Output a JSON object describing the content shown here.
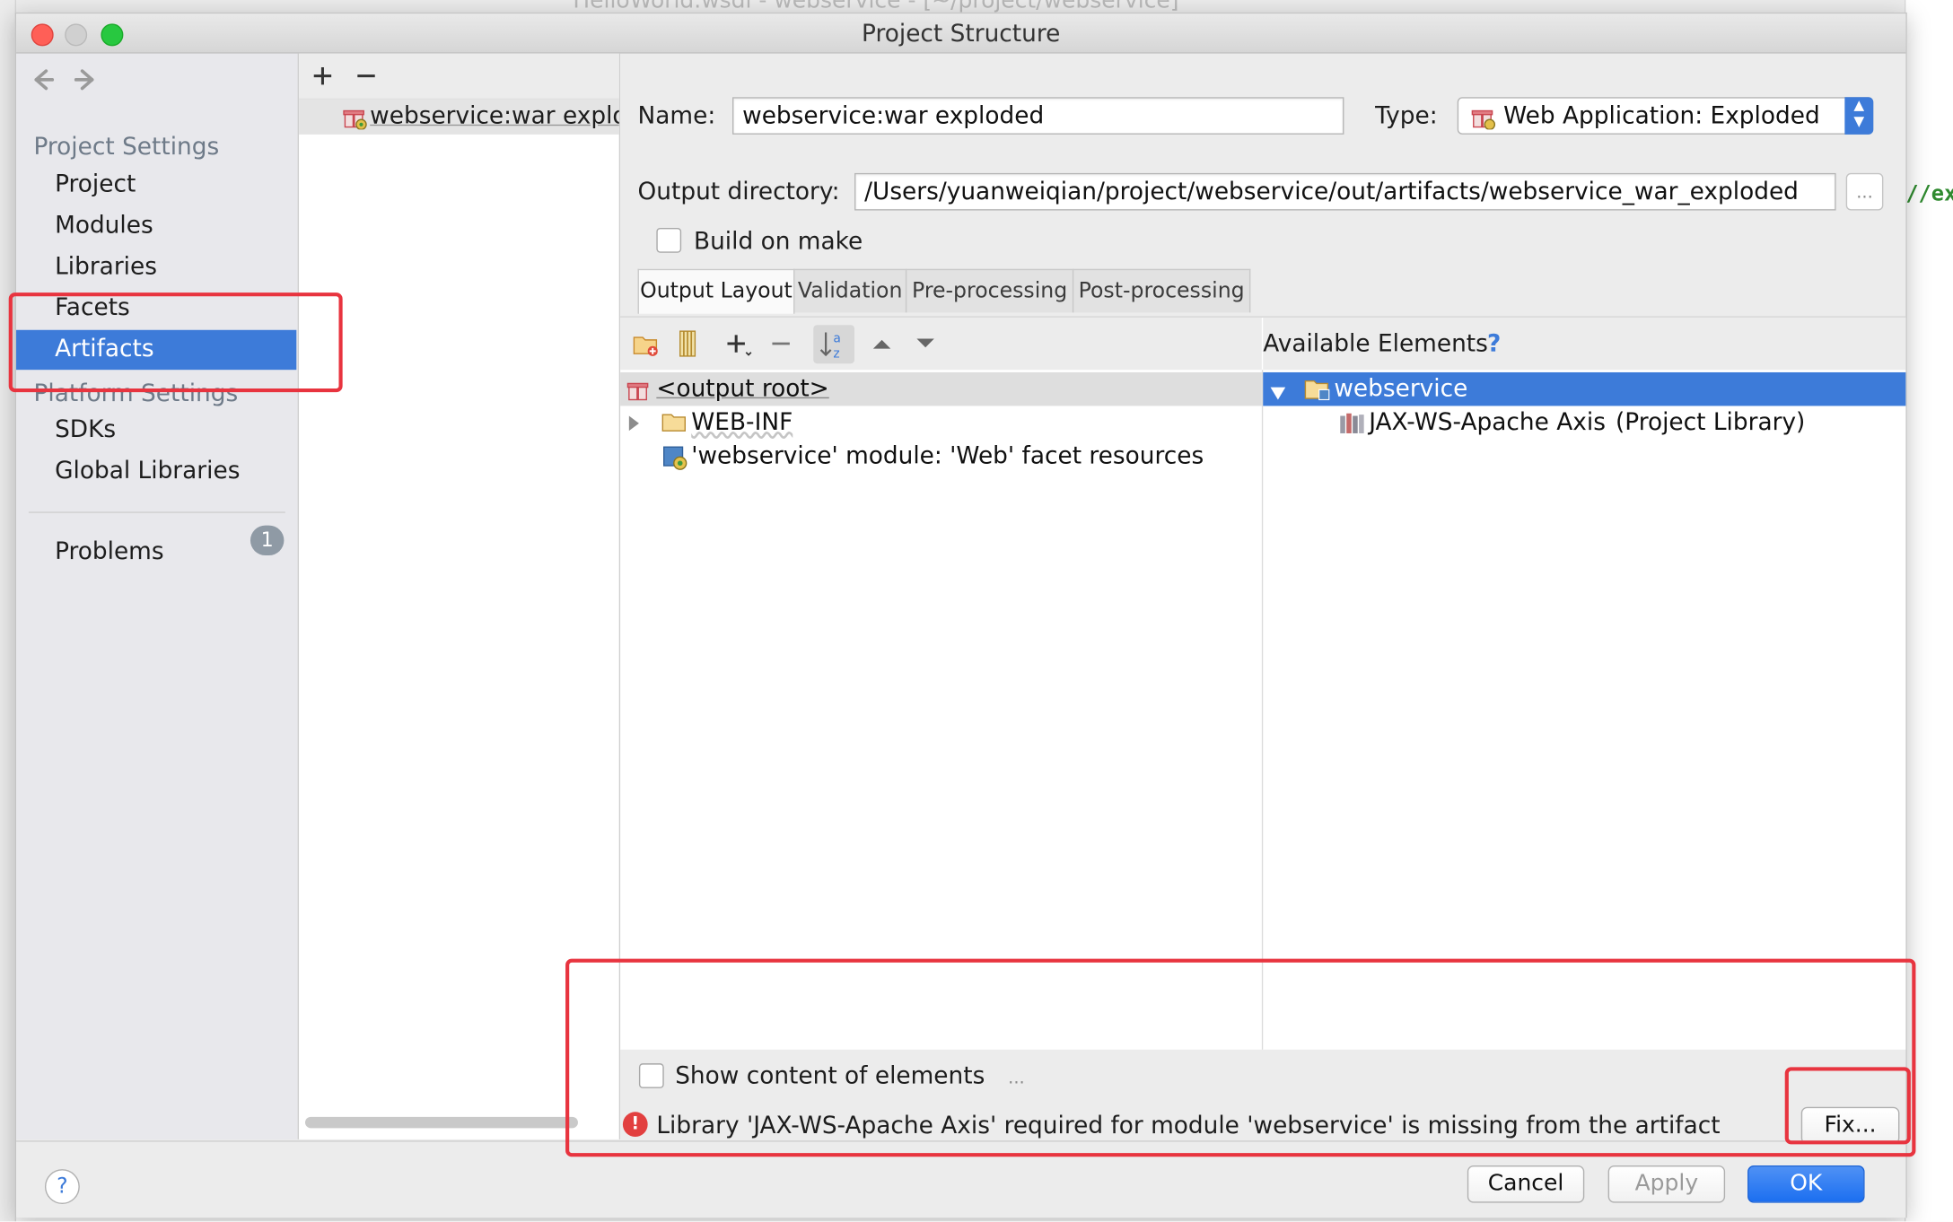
{
  "background": {
    "title_text": "HelloWorld.wsdl - webservice - [~/project/webservice]",
    "code_fragment": "//ex"
  },
  "dialog": {
    "title": "Project Structure"
  },
  "sidebar": {
    "project_settings_header": "Project Settings",
    "items": [
      {
        "label": "Project",
        "selected": false
      },
      {
        "label": "Modules",
        "selected": false
      },
      {
        "label": "Libraries",
        "selected": false
      },
      {
        "label": "Facets",
        "selected": false
      },
      {
        "label": "Artifacts",
        "selected": true
      }
    ],
    "platform_settings_header": "Platform Settings",
    "platform_items": [
      {
        "label": "SDKs"
      },
      {
        "label": "Global Libraries"
      }
    ],
    "problems_label": "Problems",
    "problems_count": "1"
  },
  "artifact_list": {
    "add_icon": "plus-icon",
    "remove_icon": "minus-icon",
    "items": [
      "webservice:war exploded"
    ]
  },
  "form": {
    "name_label": "Name:",
    "name_value": "webservice:war exploded",
    "type_label": "Type:",
    "type_value": "Web Application: Exploded",
    "output_dir_label": "Output directory:",
    "output_dir_value": "/Users/yuanweiqian/project/webservice/out/artifacts/webservice_war_exploded",
    "browse_label": "...",
    "build_on_make_label": "Build on make",
    "build_on_make_checked": false
  },
  "tabs": [
    {
      "label": "Output Layout",
      "active": true
    },
    {
      "label": "Validation",
      "active": false
    },
    {
      "label": "Pre-processing",
      "active": false
    },
    {
      "label": "Post-processing",
      "active": false
    }
  ],
  "output_layout": {
    "toolbar_icons": [
      "new-folder-icon",
      "archive-icon",
      "add-icon",
      "remove-icon",
      "sort-az-icon",
      "move-up-icon",
      "move-down-icon"
    ],
    "tree": [
      {
        "label": "<output root>",
        "icon": "artifact-gift-icon"
      },
      {
        "label": "WEB-INF",
        "icon": "folder-icon",
        "expandable": true
      },
      {
        "label": "'webservice' module: 'Web' facet resources",
        "icon": "web-facet-icon"
      }
    ]
  },
  "available_elements": {
    "header": "Available Elements",
    "help": "?",
    "tree": [
      {
        "label": "webservice",
        "selected": true,
        "expanded": true
      },
      {
        "label": "JAX-WS-Apache Axis",
        "suffix": "(Project Library)"
      }
    ]
  },
  "bottom": {
    "show_content_label": "Show content of elements",
    "show_content_checked": false,
    "more_label": "...",
    "error_message": "Library 'JAX-WS-Apache Axis' required for module 'webservice' is missing from the artifact",
    "fix_label": "Fix..."
  },
  "footer": {
    "help_label": "?",
    "cancel_label": "Cancel",
    "apply_label": "Apply",
    "ok_label": "OK"
  },
  "colors": {
    "selection": "#3d7bd9",
    "annotation_red": "#e8343f",
    "error_red": "#e23f3f"
  }
}
